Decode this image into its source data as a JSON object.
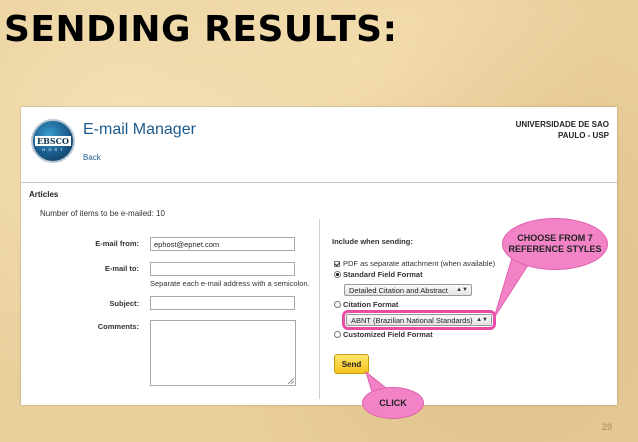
{
  "slide": {
    "title": "SENDING RESULTS:",
    "page_number": "29"
  },
  "header": {
    "logo_text": "EBSCO",
    "logo_sub": "H O S T",
    "app_title": "E-mail Manager",
    "back_label": "Back",
    "institution": "UNIVERSIDADE DE SAO PAULO - USP"
  },
  "articles": {
    "section_title": "Articles",
    "item_count_text": "Number of items to be e-mailed: 10"
  },
  "form": {
    "email_from_label": "E-mail from:",
    "email_from_value": "ephost@epnet.com",
    "email_to_label": "E-mail to:",
    "email_to_value": "",
    "email_to_hint": "Separate each e-mail address with a semicolon.",
    "subject_label": "Subject:",
    "subject_value": "",
    "comments_label": "Comments:",
    "comments_value": ""
  },
  "include": {
    "title": "Include when sending:",
    "pdf_label": "PDF as separate attachment (when available)",
    "pdf_checked": true,
    "standard_label": "Standard Field Format",
    "standard_checked": true,
    "standard_select": "Detailed Citation and Abstract",
    "citation_label": "Citation Format",
    "citation_checked": false,
    "citation_select": "ABNT (Brazilian National Standards)",
    "custom_label": "Customized Field Format",
    "custom_checked": false
  },
  "actions": {
    "send_label": "Send"
  },
  "annotations": {
    "styles_callout": "CHOOSE FROM 7 REFERENCE STYLES",
    "click_callout": "CLICK",
    "highlight_color": "#e84aa6",
    "callout_color": "#f183c6"
  }
}
